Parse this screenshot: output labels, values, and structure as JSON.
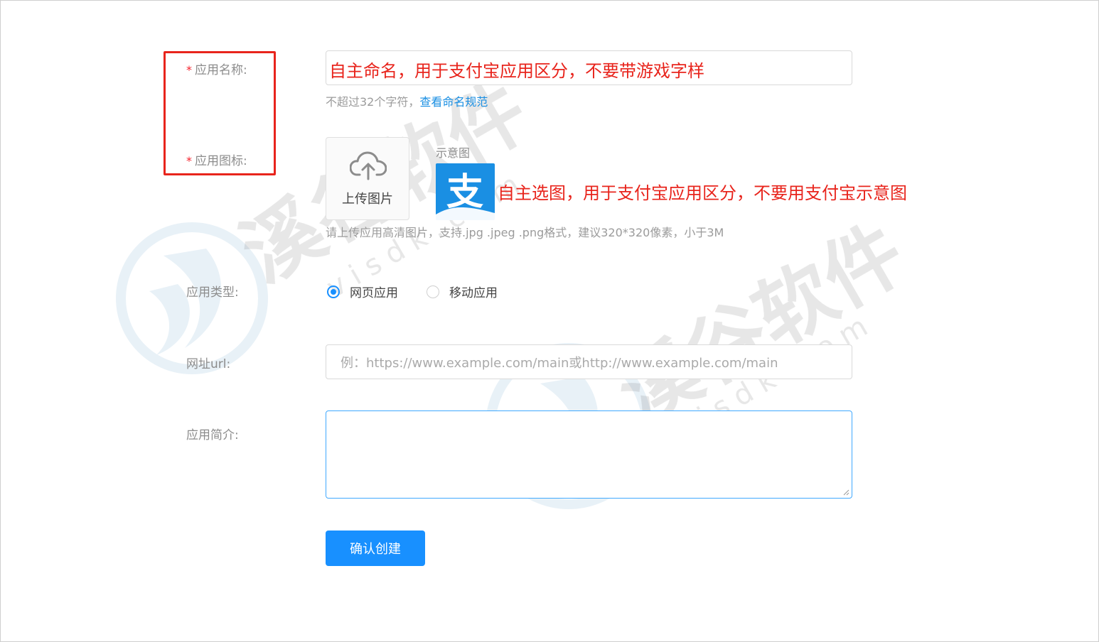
{
  "form": {
    "app_name": {
      "label": "应用名称:",
      "annotation": "自主命名，用于支付宝应用区分，不要带游戏字样",
      "hint_prefix": "不超过32个字符，",
      "hint_link": "查看命名规范"
    },
    "app_icon": {
      "label": "应用图标:",
      "upload_label": "上传图片",
      "sample_label": "示意图",
      "sample_glyph": "支",
      "annotation": "自主选图，用于支付宝应用区分，不要用支付宝示意图",
      "hint": "请上传应用高清图片，支持.jpg .jpeg .png格式，建议320*320像素，小于3M"
    },
    "app_type": {
      "label": "应用类型:",
      "options": [
        {
          "label": "网页应用",
          "selected": true
        },
        {
          "label": "移动应用",
          "selected": false
        }
      ]
    },
    "url": {
      "label": "网址url:",
      "placeholder": "例：https://www.example.com/main或http://www.example.com/main"
    },
    "description": {
      "label": "应用简介:",
      "value": ""
    },
    "submit_label": "确认创建"
  },
  "watermark": {
    "text": "溪谷软件",
    "domain": "v i s d k . c o m"
  },
  "colors": {
    "primary": "#1890ff",
    "annotation_red": "#e8241c",
    "required_star": "#f5222d",
    "alipay_blue": "#1a8fe3"
  },
  "icons": {
    "upload": "cloud-upload-icon",
    "alipay": "alipay-logo",
    "radio_on": "radio-checked",
    "radio_off": "radio-unchecked"
  }
}
